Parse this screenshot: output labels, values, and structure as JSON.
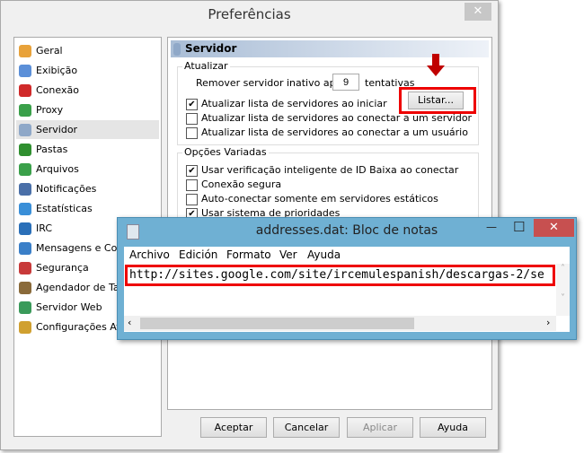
{
  "prefs": {
    "title": "Preferências",
    "close": "✕",
    "sidebar": [
      {
        "label": "Geral",
        "color": "#e8a23a"
      },
      {
        "label": "Exibição",
        "color": "#5b8fd8"
      },
      {
        "label": "Conexão",
        "color": "#d02a2a"
      },
      {
        "label": "Proxy",
        "color": "#3aa04a"
      },
      {
        "label": "Servidor",
        "color": "#8fa8c8"
      },
      {
        "label": "Pastas",
        "color": "#2f8f2f"
      },
      {
        "label": "Arquivos",
        "color": "#3aa04a"
      },
      {
        "label": "Notificações",
        "color": "#4a6fa8"
      },
      {
        "label": "Estatísticas",
        "color": "#3a8fd8"
      },
      {
        "label": "IRC",
        "color": "#2a6fb8"
      },
      {
        "label": "Mensagens e Comentários",
        "color": "#3a7fc8"
      },
      {
        "label": "Segurança",
        "color": "#c83a3a"
      },
      {
        "label": "Agendador de Tarefas",
        "color": "#8a6a3a"
      },
      {
        "label": "Servidor Web",
        "color": "#3a9a5a"
      },
      {
        "label": "Configurações Avançadas",
        "color": "#d0a030"
      }
    ],
    "selected": "Servidor",
    "panel": {
      "header": "Servidor",
      "atualizar": {
        "label": "Atualizar",
        "remove_prefix": "Remover servidor inativo após",
        "remove_value": "9",
        "remove_suffix": "tentativas",
        "list_button": "Listar...",
        "options": [
          {
            "label": "Atualizar lista de servidores ao iniciar",
            "checked": true
          },
          {
            "label": "Atualizar lista de servidores ao conectar a um servidor",
            "checked": false
          },
          {
            "label": "Atualizar lista de servidores ao conectar a um usuário",
            "checked": false
          }
        ]
      },
      "variadas": {
        "label": "Opções Variadas",
        "options": [
          {
            "label": "Usar verificação inteligente de ID Baixa ao conectar",
            "checked": true
          },
          {
            "label": "Conexão segura",
            "checked": false
          },
          {
            "label": "Auto-conectar somente em servidores estáticos",
            "checked": false
          },
          {
            "label": "Usar sistema de prioridades",
            "checked": true
          }
        ]
      }
    },
    "buttons": {
      "accept": "Aceptar",
      "cancel": "Cancelar",
      "apply": "Aplicar",
      "help": "Ayuda"
    }
  },
  "notepad": {
    "title": "addresses.dat: Bloc de notas",
    "menu": [
      "Archivo",
      "Edición",
      "Formato",
      "Ver",
      "Ayuda"
    ],
    "text": "http://sites.google.com/site/ircemulespanish/descargas-2/se",
    "close": "✕",
    "minimize": "—",
    "maximize": "☐"
  },
  "colors": {
    "highlight": "#e00000",
    "arrow": "#c00000"
  }
}
